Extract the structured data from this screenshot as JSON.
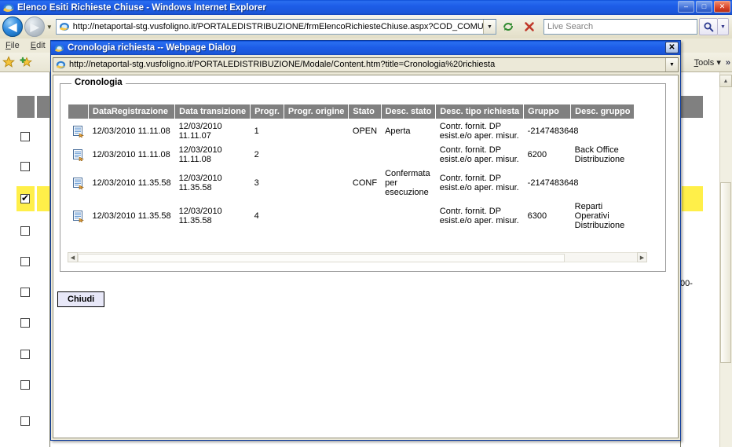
{
  "window": {
    "title": "Elenco Esiti Richieste Chiuse - Windows Internet Explorer",
    "minimize_label": "–",
    "maximize_label": "□",
    "close_label": "✕",
    "icon": "ie-logo-icon"
  },
  "toolbar": {
    "back_label": "◀",
    "forward_label": "▶",
    "history_dropdown_label": "▼",
    "address": {
      "url": "http://netaportal-stg.vusfoligno.it/PORTALEDISTRIBUZIONE/frmElencoRichiesteChiuse.aspx?COD_COMUN",
      "dropdown_label": "▼",
      "favicon": "page-icon"
    },
    "refresh_label": "refresh-icon",
    "stop_label": "✕",
    "search": {
      "placeholder": "Live Search",
      "go_label": "search-icon",
      "dropdown_label": "▼"
    }
  },
  "menubar": {
    "items": [
      {
        "label": "File",
        "accel": "F"
      },
      {
        "label": "Edit",
        "accel": "E"
      }
    ]
  },
  "commandbar": {
    "favorites_icon": "star-icon",
    "add_favorite_icon": "star-plus-icon",
    "tools_label": "Tools",
    "tools_dropdown_label": "▾",
    "overflow_label": "»"
  },
  "background_page": {
    "highlight_color": "#ffef49",
    "header_color": "#808080",
    "truncated_text": "00-",
    "checkbox_rows": [
      {
        "checked": false,
        "highlighted": false
      },
      {
        "checked": false,
        "highlighted": false
      },
      {
        "checked": true,
        "highlighted": true
      },
      {
        "checked": false,
        "highlighted": false
      },
      {
        "checked": false,
        "highlighted": false
      },
      {
        "checked": false,
        "highlighted": false
      },
      {
        "checked": false,
        "highlighted": false
      },
      {
        "checked": false,
        "highlighted": false
      }
    ],
    "scrollbar": {
      "up_label": "▲",
      "down_label": "▼"
    }
  },
  "dialog": {
    "title": "Cronologia richiesta -- Webpage Dialog",
    "icon": "ie-page-icon",
    "close_label": "✕",
    "address": {
      "url": "http://netaportal-stg.vusfoligno.it/PORTALEDISTRIBUZIONE/Modale/Content.htm?title=Cronologia%20richiesta",
      "dropdown_label": "▼",
      "favicon": "page-icon"
    },
    "fieldset_legend": "Cronologia",
    "close_button_label": "Chiudi",
    "grid": {
      "columns": [
        "",
        "DataRegistrazione",
        "Data transizione",
        "Progr.",
        "Progr. origine",
        "Stato",
        "Desc. stato",
        "Desc. tipo richiesta",
        "Gruppo",
        "Desc. gruppo"
      ],
      "row_icon": "document-detail-icon",
      "rows": [
        {
          "data_registrazione": "12/03/2010 11.11.08",
          "data_transizione": "12/03/2010 11.11.07",
          "progr": "1",
          "progr_origine": "",
          "stato": "OPEN",
          "desc_stato": "Aperta",
          "desc_tipo_richiesta": "Contr. fornit. DP esist.e/o aper. misur.",
          "gruppo": "-2147483648",
          "desc_gruppo": ""
        },
        {
          "data_registrazione": "12/03/2010 11.11.08",
          "data_transizione": "12/03/2010 11.11.08",
          "progr": "2",
          "progr_origine": "",
          "stato": "",
          "desc_stato": "",
          "desc_tipo_richiesta": "Contr. fornit. DP esist.e/o aper. misur.",
          "gruppo": "6200",
          "desc_gruppo": "Back Office Distribuzione"
        },
        {
          "data_registrazione": "12/03/2010 11.35.58",
          "data_transizione": "12/03/2010 11.35.58",
          "progr": "3",
          "progr_origine": "",
          "stato": "CONF",
          "desc_stato": "Confermata per esecuzione",
          "desc_tipo_richiesta": "Contr. fornit. DP esist.e/o aper. misur.",
          "gruppo": "-2147483648",
          "desc_gruppo": ""
        },
        {
          "data_registrazione": "12/03/2010 11.35.58",
          "data_transizione": "12/03/2010 11.35.58",
          "progr": "4",
          "progr_origine": "",
          "stato": "",
          "desc_stato": "",
          "desc_tipo_richiesta": "Contr. fornit. DP esist.e/o aper. misur.",
          "gruppo": "6300",
          "desc_gruppo": "Reparti Operativi Distribuzione"
        }
      ],
      "hscroll": {
        "left_label": "◀",
        "right_label": "▶"
      }
    }
  }
}
